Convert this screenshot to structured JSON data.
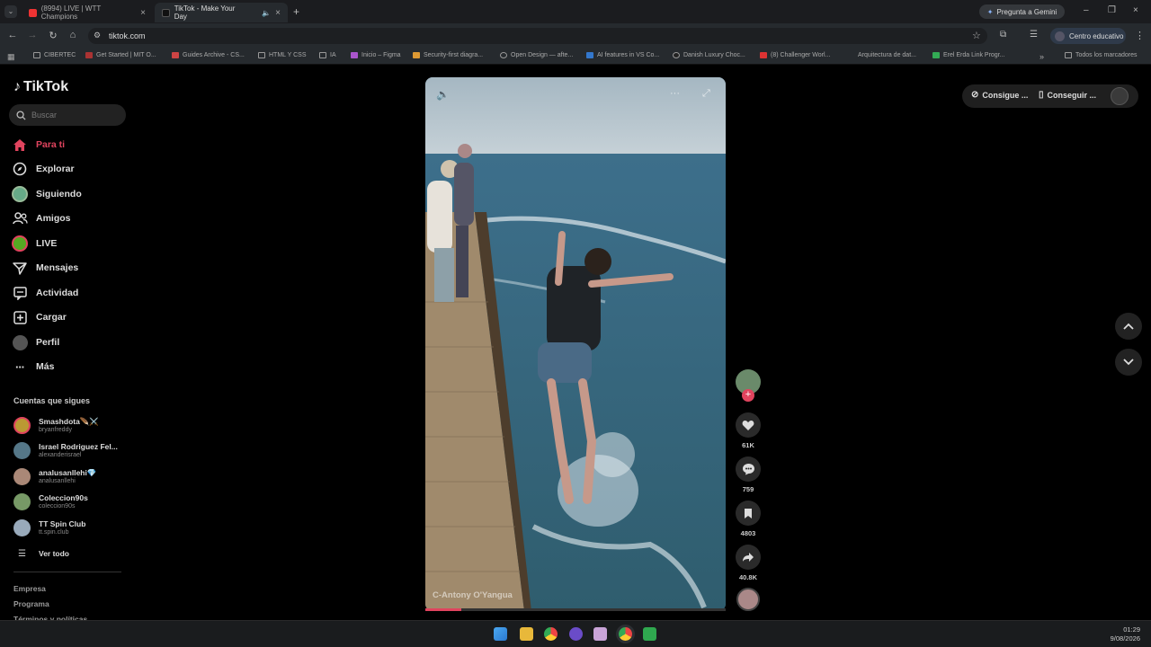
{
  "browser": {
    "tabs": [
      {
        "label": "(8994) LIVE | WTT Champions",
        "active": false
      },
      {
        "label": "TikTok - Make Your Day",
        "active": true
      }
    ],
    "url": "tiktok.com",
    "gemini_label": "Pregunta a Gemini",
    "profile_label": "Centro educativo",
    "bookmarks": [
      "CIBERTEC",
      "Get Started | MIT O...",
      "Guides Archive - CS...",
      "HTML Y CSS",
      "IA",
      "Inicio – Figma",
      "Security-first diagra...",
      "Open Design — afte...",
      "AI features in VS Co...",
      "Danish Luxury Choc...",
      "(8) Challenger Worl...",
      "Arquitectura de dat...",
      "Erel Erda Link Progr..."
    ],
    "all_bookmarks_label": "Todos los marcadores"
  },
  "tiktok": {
    "logo": "TikTok",
    "search_placeholder": "Buscar",
    "nav": [
      {
        "label": "Para ti",
        "icon": "home-icon",
        "active": true
      },
      {
        "label": "Explorar",
        "icon": "compass-icon"
      },
      {
        "label": "Siguiendo",
        "icon": "following-avatar-icon"
      },
      {
        "label": "Amigos",
        "icon": "friends-icon"
      },
      {
        "label": "LIVE",
        "icon": "live-icon"
      },
      {
        "label": "Mensajes",
        "icon": "messages-icon"
      },
      {
        "label": "Actividad",
        "icon": "activity-icon"
      },
      {
        "label": "Cargar",
        "icon": "upload-icon"
      },
      {
        "label": "Perfil",
        "icon": "profile-avatar-icon"
      },
      {
        "label": "Más",
        "icon": "more-icon"
      }
    ],
    "following_title": "Cuentas que sigues",
    "following": [
      {
        "name": "Smashdota🪶⚔️",
        "handle": "bryanfreddy"
      },
      {
        "name": "Israel Rodriguez Fel...",
        "handle": "alexanderisrael"
      },
      {
        "name": "analusanllehi💎",
        "handle": "analusanllehi"
      },
      {
        "name": "Coleccion90s",
        "handle": "coleccion90s"
      },
      {
        "name": "TT Spin Club",
        "handle": "tt.spin.club"
      }
    ],
    "see_all": "Ver todo",
    "footer": [
      "Empresa",
      "Programa",
      "Términos y políticas"
    ],
    "top_buttons": [
      "Consigue ...",
      "Conseguir ..."
    ]
  },
  "video": {
    "credit": "C-Antony O'Yangua",
    "progress": 0.12,
    "likes": "61K",
    "comments": "759",
    "saves": "4803",
    "shares": "40.8K"
  },
  "taskbar": {
    "time": "01:29",
    "date": "9/08/2026"
  }
}
